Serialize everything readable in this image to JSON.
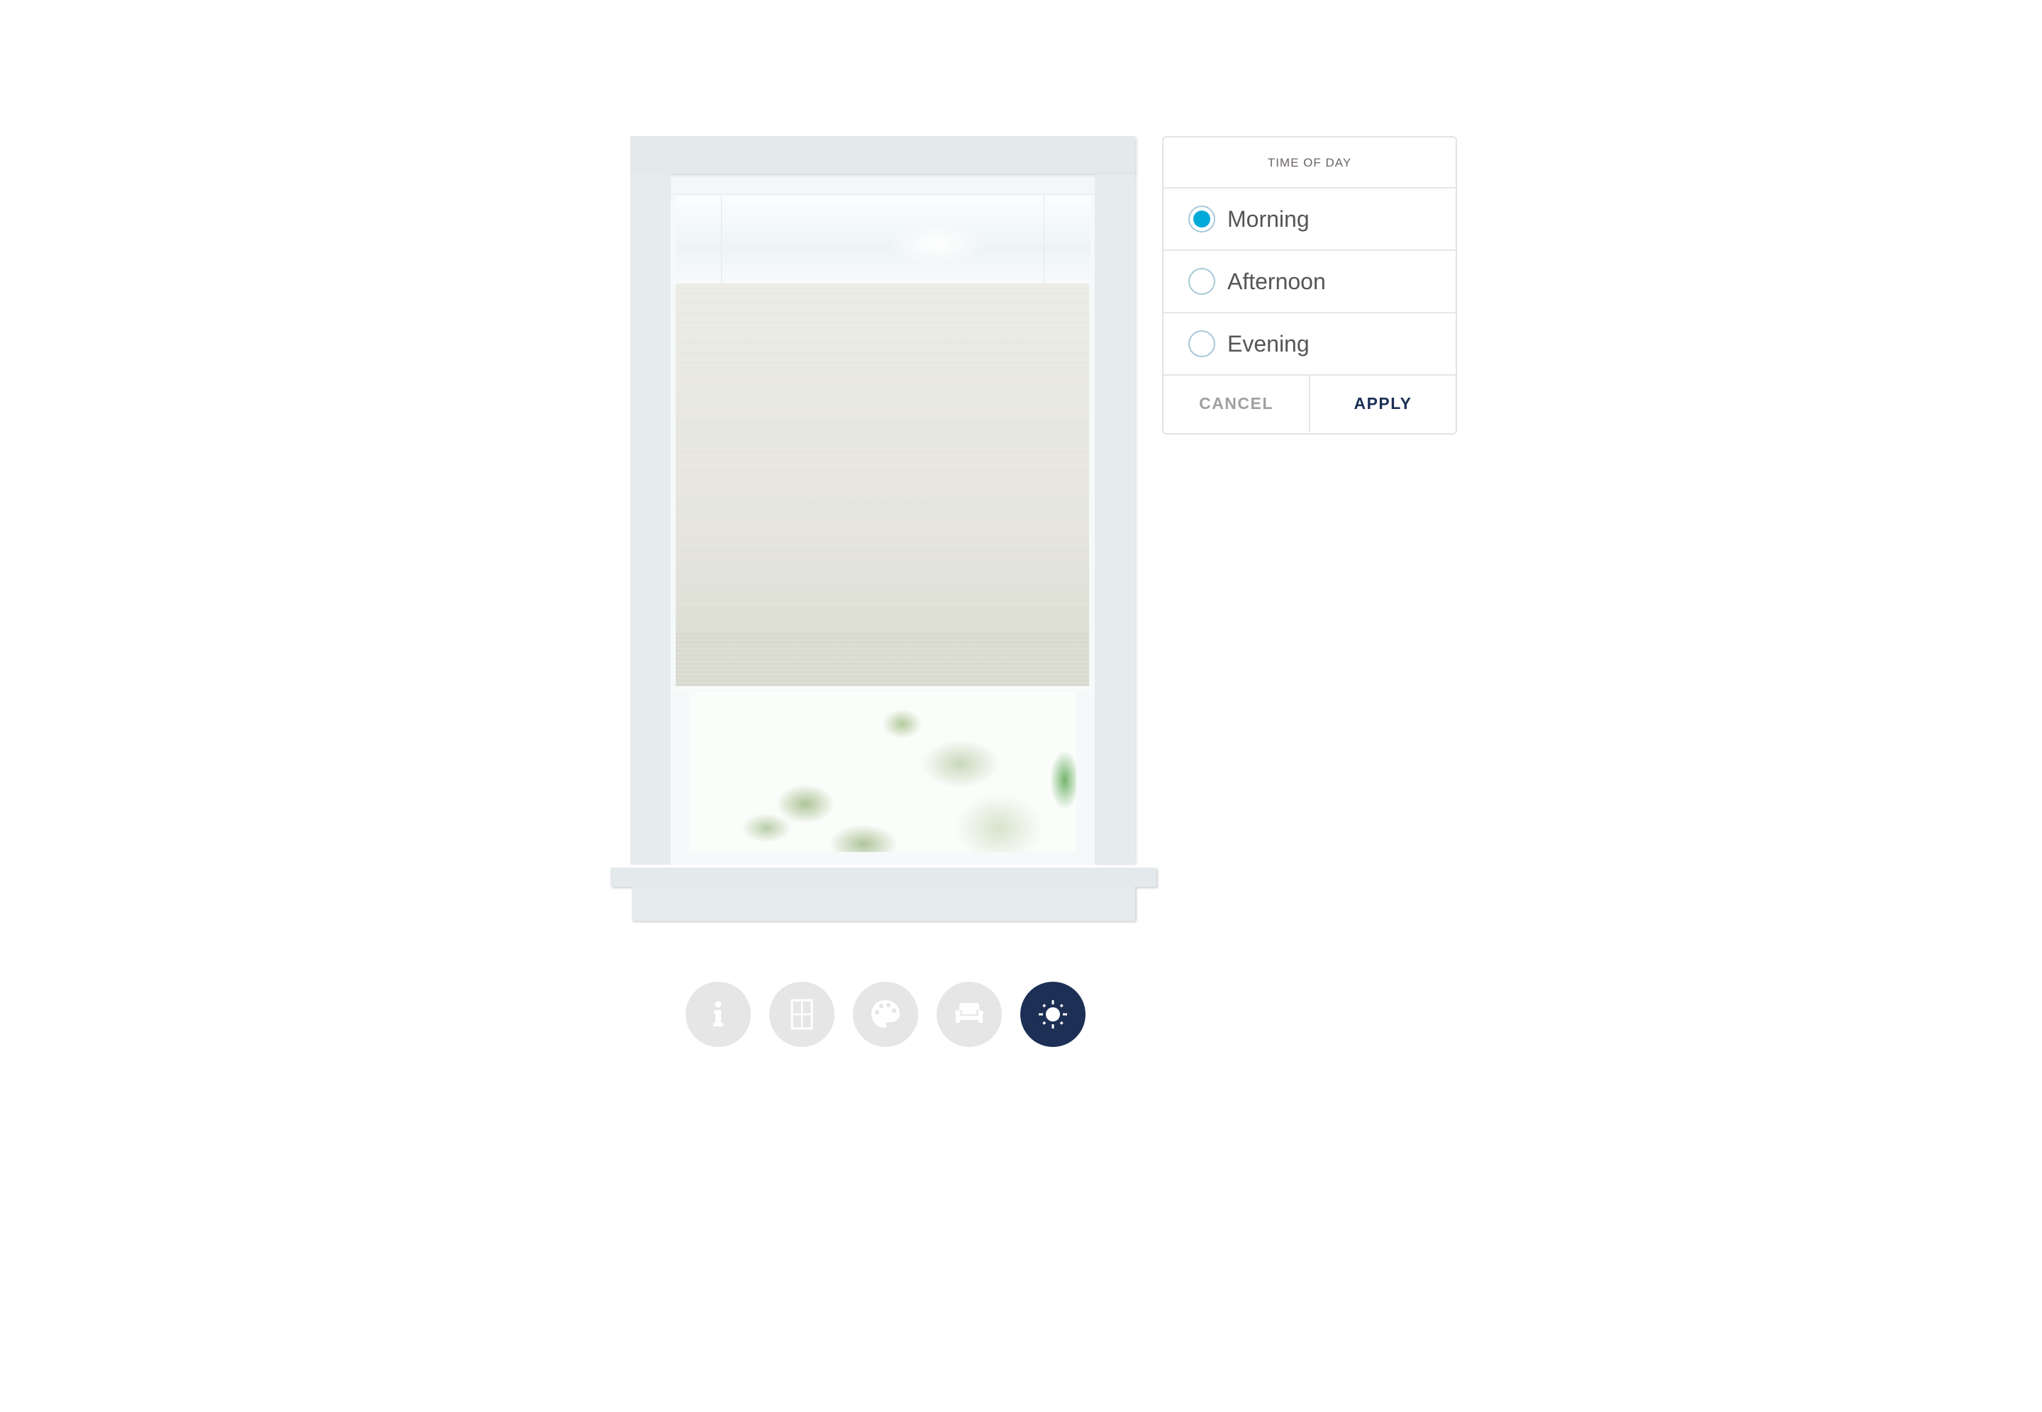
{
  "time_of_day_panel": {
    "title": "TIME OF DAY",
    "options": [
      {
        "label": "Morning",
        "selected": true
      },
      {
        "label": "Afternoon",
        "selected": false
      },
      {
        "label": "Evening",
        "selected": false
      }
    ],
    "cancel_label": "CANCEL",
    "apply_label": "APPLY"
  },
  "toolbar": {
    "buttons": [
      {
        "name": "info",
        "icon": "info-icon",
        "active": false
      },
      {
        "name": "window",
        "icon": "window-icon",
        "active": false
      },
      {
        "name": "color",
        "icon": "palette-icon",
        "active": false
      },
      {
        "name": "room",
        "icon": "sofa-icon",
        "active": false
      },
      {
        "name": "time-of-day",
        "icon": "sun-icon",
        "active": true
      }
    ]
  },
  "colors": {
    "accent_radio": "#00aad8",
    "apply_text": "#1b2f55",
    "active_tool": "#1d2f55",
    "inactive_tool": "#e6e6e6"
  }
}
